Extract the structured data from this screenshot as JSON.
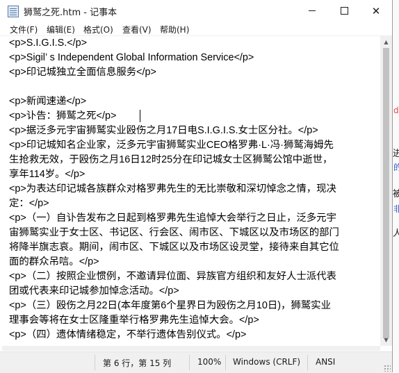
{
  "window": {
    "title": "狮鹫之死.htm - 记事本",
    "buttons": {
      "minimize": "minimize",
      "maximize": "maximize",
      "close": "✕"
    }
  },
  "menu": [
    "文件(F)",
    "编辑(E)",
    "格式(O)",
    "查看(V)",
    "帮助(H)"
  ],
  "document": {
    "lines": [
      "<p>S.I.G.I.S.</p>",
      "<p>Sigil’ s Independent Global Information Service</p>",
      "<p>印记城独立全面信息服务</p>",
      "",
      "<p>新闻速递</p>",
      "<p>讣告：狮鹫之死</p>",
      "<p>据泛多元宇宙狮鹫实业殴伤之月17日电S.I.G.I.S.女士区分社。</p>",
      "<p>印记城知名企业家，泛多元宇宙狮鹫实业CEO格罗弗·L·冯·狮鹫海姆先",
      "生抢救无效，于殴伤之月16日12时25分在印记城女士区狮鹫公馆中逝世，",
      "享年114岁。</p>",
      "<p>为表达印记城各族群众对格罗弗先生的无比崇敬和深切悼念之情，现决",
      "定：</p>",
      "<p>（一）自讣告发布之日起到格罗弗先生追悼大会举行之日止，泛多元宇",
      "宙狮鹫实业于女士区、书记区、行会区、闹市区、下城区以及市场区的部门",
      "将降半旗志哀。期间，闹市区、下城区以及市场区设灵堂，接待来自其它位",
      "面的群众吊唁。</p>",
      "<p>（二）按照企业惯例，不邀请异位面、异族官方组织和友好人士派代表",
      "团或代表来印记城参加悼念活动。</p>",
      "<p>（三）殴伤之月22日(本年度第6个星界日为殴伤之月10日)，狮鹫实业",
      "理事会等将在女士区隆重举行格罗弗先生追悼大会。</p>",
      "<p>（四）遗体情绪稳定，不举行遗体告别仪式。</p>"
    ]
  },
  "status": {
    "position": "第 6 行，第 15 列",
    "zoom": "100%",
    "line_ending": "Windows (CRLF)",
    "encoding": "ANSI"
  },
  "background": {
    "strip_glyphs": [
      "di",
      "进",
      "的",
      "被",
      "非",
      "人"
    ]
  },
  "colors": {
    "titlebar": "#ffffff",
    "statusbar": "#f0f0f0",
    "scrollbar_thumb": "#c2c2c2"
  }
}
